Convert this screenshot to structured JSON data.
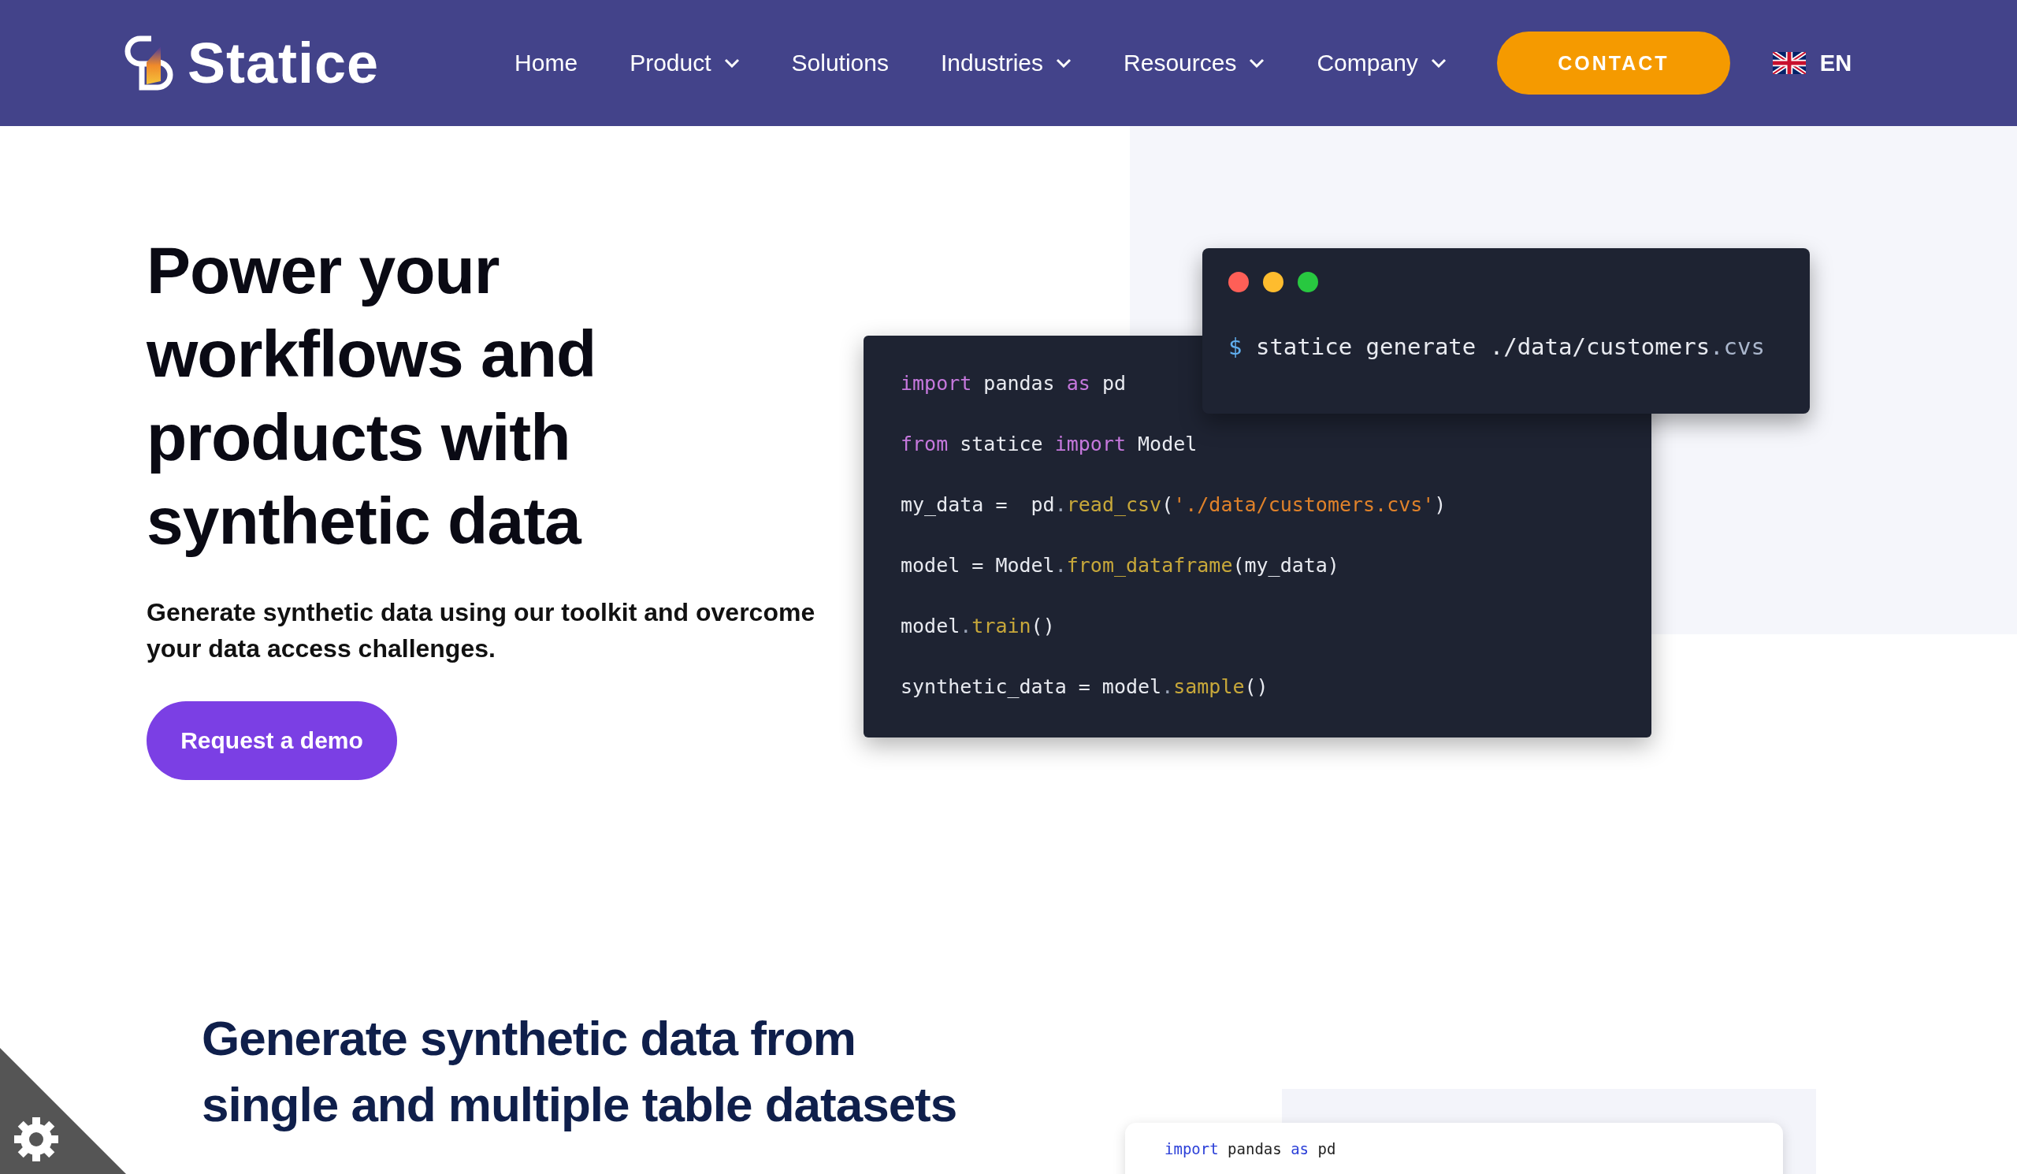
{
  "nav": {
    "logo": "Statice",
    "items": [
      {
        "label": "Home",
        "dropdown": false
      },
      {
        "label": "Product",
        "dropdown": true
      },
      {
        "label": "Solutions",
        "dropdown": false
      },
      {
        "label": "Industries",
        "dropdown": true
      },
      {
        "label": "Resources",
        "dropdown": true
      },
      {
        "label": "Company",
        "dropdown": true
      }
    ],
    "contact": "CONTACT",
    "language": "EN"
  },
  "hero": {
    "title_lines": [
      "Power your",
      "workflows and",
      "products with",
      "synthetic data"
    ],
    "subtitle": "Generate synthetic data using our toolkit and overcome your data access challenges.",
    "button": "Request a demo",
    "terminal": {
      "prompt": "$",
      "command": [
        {
          "kind": "plain",
          "text": "statice generate ./data/customers"
        },
        {
          "kind": "ext",
          "text": ".cvs"
        }
      ]
    },
    "code": [
      [
        {
          "kind": "kw",
          "text": "import"
        },
        {
          "kind": "plain",
          "text": " pandas "
        },
        {
          "kind": "kw",
          "text": "as"
        },
        {
          "kind": "plain",
          "text": " pd"
        }
      ],
      [
        {
          "kind": "kw",
          "text": "from"
        },
        {
          "kind": "plain",
          "text": " statice "
        },
        {
          "kind": "kw",
          "text": "import"
        },
        {
          "kind": "plain",
          "text": " Model"
        }
      ],
      [
        {
          "kind": "plain",
          "text": "my_data =  pd"
        },
        {
          "kind": "punct",
          "text": "."
        },
        {
          "kind": "fn",
          "text": "read_csv"
        },
        {
          "kind": "plain",
          "text": "("
        },
        {
          "kind": "str",
          "text": "'./data/customers.cvs'"
        },
        {
          "kind": "plain",
          "text": ")"
        }
      ],
      [
        {
          "kind": "plain",
          "text": "model = Model"
        },
        {
          "kind": "punct",
          "text": "."
        },
        {
          "kind": "fn",
          "text": "from_dataframe"
        },
        {
          "kind": "plain",
          "text": "(my_data)"
        }
      ],
      [
        {
          "kind": "plain",
          "text": "model"
        },
        {
          "kind": "punct",
          "text": "."
        },
        {
          "kind": "fn",
          "text": "train"
        },
        {
          "kind": "plain",
          "text": "()"
        }
      ],
      [
        {
          "kind": "plain",
          "text": "synthetic_data = model"
        },
        {
          "kind": "punct",
          "text": "."
        },
        {
          "kind": "fn",
          "text": "sample"
        },
        {
          "kind": "plain",
          "text": "()"
        }
      ]
    ]
  },
  "feature": {
    "title_lines": [
      "Generate synthetic data from",
      "single and multiple table datasets"
    ],
    "code": [
      [
        {
          "kind": "kw",
          "text": "import"
        },
        {
          "kind": "plain",
          "text": " pandas "
        },
        {
          "kind": "kw",
          "text": "as"
        },
        {
          "kind": "plain",
          "text": " pd"
        }
      ]
    ]
  }
}
